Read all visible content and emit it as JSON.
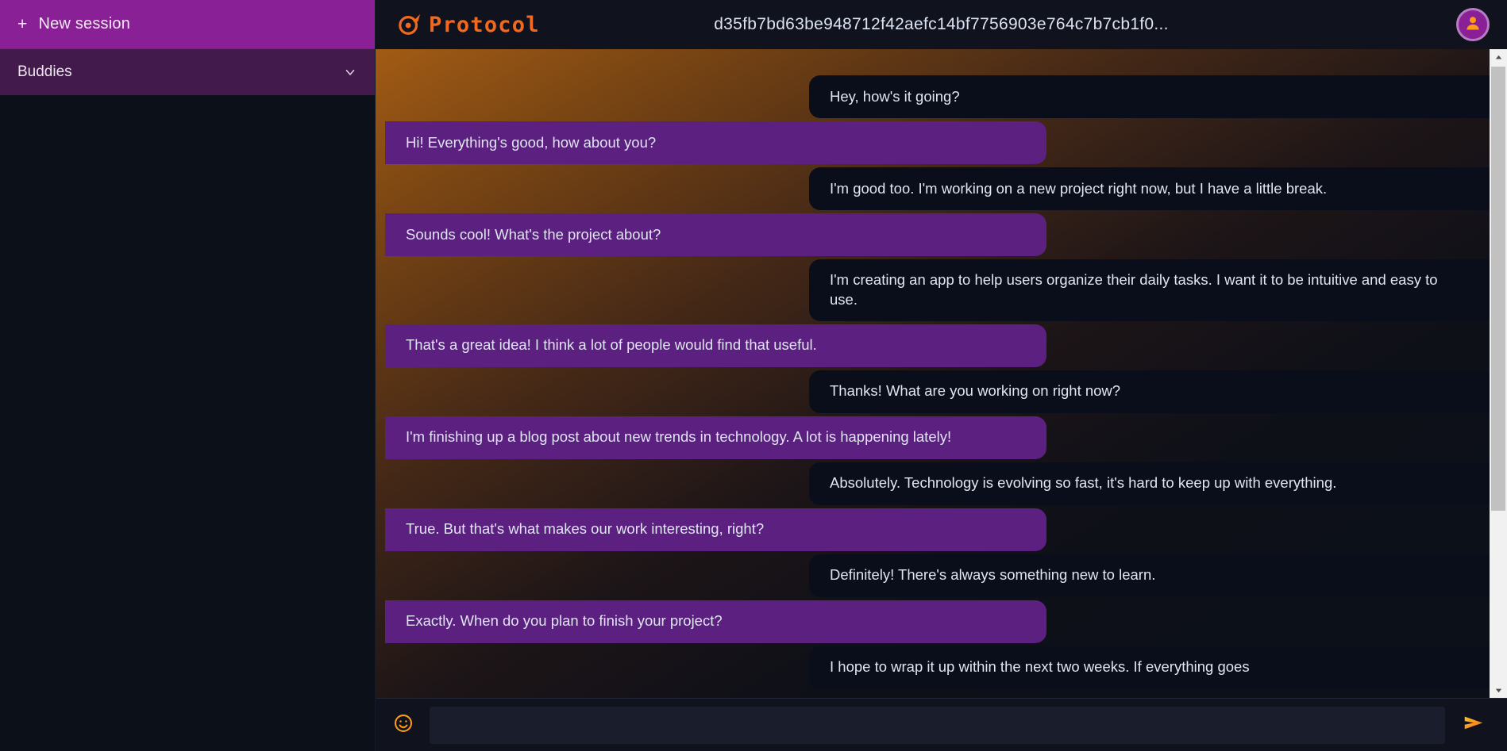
{
  "app": {
    "brand_name": "Protocol",
    "brand_color": "#f2691e",
    "accent_purple": "#8a2096",
    "bubble_out_color": "#5b2080",
    "bubble_in_color": "#0a0e1a"
  },
  "sidebar": {
    "new_session_label": "New session",
    "new_session_plus": "+",
    "buddies_label": "Buddies",
    "buddies_chevron_icon": "chevron-down-icon"
  },
  "topbar": {
    "logo_icon": "protocol-logo-icon",
    "brand": "Protocol",
    "session_title": "d35fb7bd63be948712f42aefc14bf7756903e764c7b7cb1f0...",
    "avatar_icon": "user-avatar-icon"
  },
  "chat": {
    "messages": [
      {
        "side": "right",
        "variant": "in",
        "text": "Hey, how's it going?"
      },
      {
        "side": "left",
        "variant": "out",
        "text": "Hi! Everything's good, how about you?"
      },
      {
        "side": "right",
        "variant": "in",
        "text": "I'm good too. I'm working on a new project right now, but I have a little break."
      },
      {
        "side": "left",
        "variant": "out",
        "text": "Sounds cool! What's the project about?"
      },
      {
        "side": "right",
        "variant": "in",
        "text": "I'm creating an app to help users organize their daily tasks. I want it to be intuitive and easy to use."
      },
      {
        "side": "left",
        "variant": "out",
        "text": "That's a great idea! I think a lot of people would find that useful."
      },
      {
        "side": "right",
        "variant": "in",
        "text": "Thanks! What are you working on right now?"
      },
      {
        "side": "left",
        "variant": "out",
        "text": "I'm finishing up a blog post about new trends in technology. A lot is happening lately!"
      },
      {
        "side": "right",
        "variant": "in",
        "text": "Absolutely. Technology is evolving so fast, it's hard to keep up with everything."
      },
      {
        "side": "left",
        "variant": "out",
        "text": "True. But that's what makes our work interesting, right?"
      },
      {
        "side": "right",
        "variant": "in",
        "text": "Definitely! There's always something new to learn."
      },
      {
        "side": "left",
        "variant": "out",
        "text": "Exactly. When do you plan to finish your project?"
      },
      {
        "side": "right",
        "variant": "in",
        "text": "I hope to wrap it up within the next two weeks. If everything goes"
      }
    ]
  },
  "composer": {
    "emoji_icon": "emoji-smiley-icon",
    "input_value": "",
    "input_placeholder": "",
    "send_icon": "send-arrow-icon"
  },
  "scrollbar": {
    "up_icon": "scroll-up-arrow-icon",
    "down_icon": "scroll-down-arrow-icon"
  }
}
